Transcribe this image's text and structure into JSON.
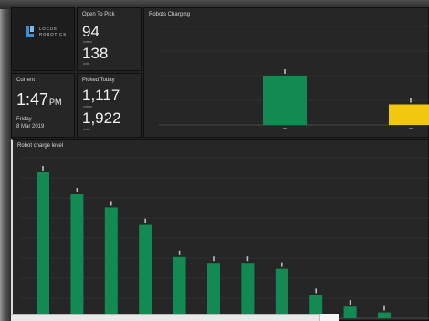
{
  "brand": {
    "name_line1": "LOCUS",
    "name_line2": "ROBOTICS",
    "mark_color": "#3a8fd8"
  },
  "open_to_pick": {
    "title": "Open To Pick",
    "value1": "94",
    "unit1": "orders",
    "value2": "138",
    "unit2": "units"
  },
  "current": {
    "title": "Current",
    "time": "1:47",
    "ampm": "PM",
    "day": "Friday",
    "date": "8 Mar 2019"
  },
  "picked_today": {
    "title": "Picked Today",
    "value1": "1,117",
    "unit1": "orders",
    "value2": "1,922",
    "unit2": "units"
  },
  "charging": {
    "title": "Robots Charging"
  },
  "charge_level": {
    "title": "Robot charge level"
  },
  "chart_data": [
    {
      "type": "bar",
      "title": "Robots Charging",
      "ylim": [
        0,
        12
      ],
      "grid": true,
      "categories": [
        "",
        ""
      ],
      "values": [
        6,
        2.5
      ],
      "colors": [
        "#138a52",
        "#f2c80f"
      ]
    },
    {
      "type": "bar",
      "title": "Robot charge level",
      "ylim": [
        0,
        11
      ],
      "grid": true,
      "values": [
        10,
        8.5,
        7.6,
        6.4,
        4.2,
        3.8,
        3.8,
        3.4,
        1.6,
        0.8,
        0.4
      ],
      "color": "#138a52"
    }
  ]
}
